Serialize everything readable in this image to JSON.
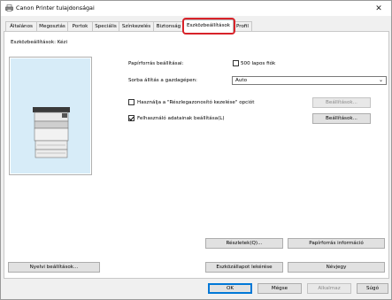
{
  "window": {
    "title": "Canon Printer tulajdonságai",
    "close_glyph": "✕"
  },
  "tabs": [
    {
      "label": "Általános"
    },
    {
      "label": "Megosztás"
    },
    {
      "label": "Portok"
    },
    {
      "label": "Speciális"
    },
    {
      "label": "Színkezelés"
    },
    {
      "label": "Biztonság"
    },
    {
      "label": "Eszközbeállítások"
    },
    {
      "label": "Profil"
    }
  ],
  "active_tab": "Eszközbeállítások",
  "highlight_color": "#d8232a",
  "panel": {
    "device_settings_label": "Eszközbeállítások: Kézi",
    "paper_source_label": "Papírforrás beállításai:",
    "paper_source_checkbox_label": "500 lapos fiók",
    "paper_source_checked": false,
    "sort_label": "Sorba állítás a gazdagépen:",
    "sort_value": "Auto",
    "department_checkbox_label": "Használja a \"Részlegazonosító kezelése\" opciót",
    "department_checked": false,
    "department_settings_button": "Beállítások...",
    "user_info_checkbox_label": "Felhasználó adatainak beállítása(L)",
    "user_info_checked": true,
    "user_info_settings_button": "Beállítások...",
    "details_button": "Részletek(Q)...",
    "paper_info_button": "Papírforrás információ",
    "language_button": "Nyelvi beállítások...",
    "get_device_status_button": "Eszközállapot lekérése",
    "about_button": "Névjegy"
  },
  "footer": {
    "ok": "OK",
    "cancel": "Mégse",
    "apply": "Alkalmaz",
    "help": "Súgó"
  }
}
